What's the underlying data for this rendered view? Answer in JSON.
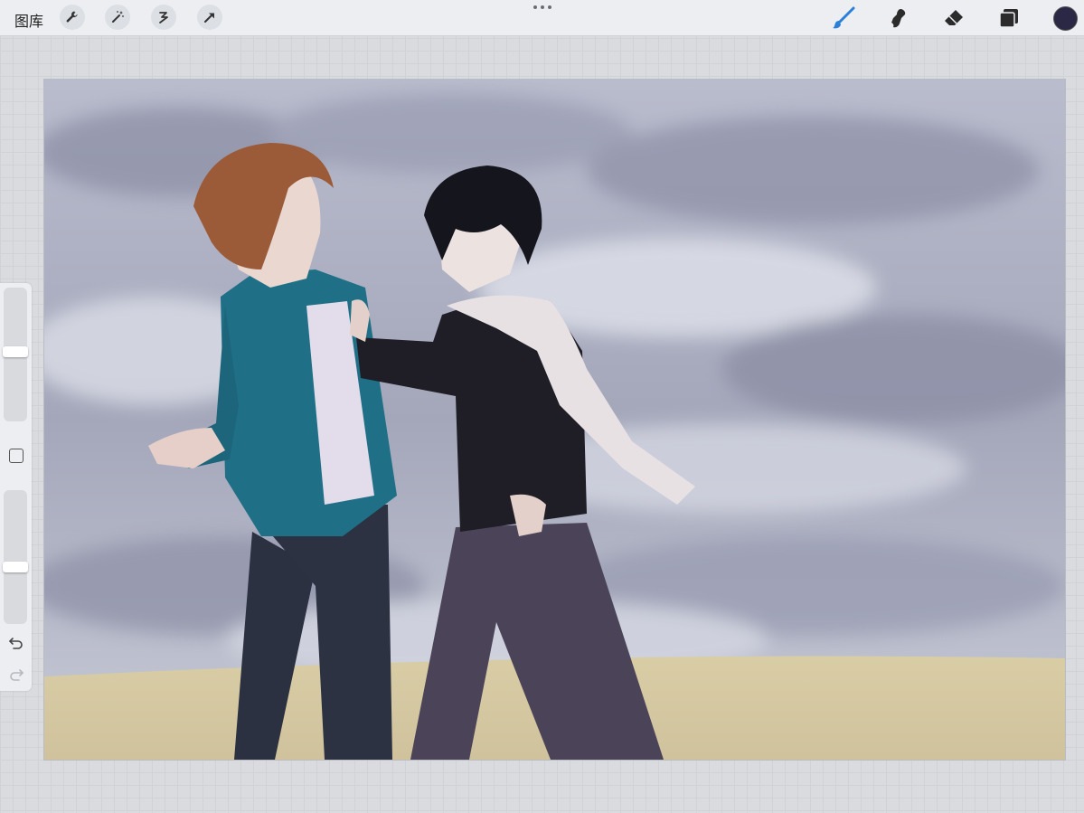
{
  "topbar": {
    "gallery_label": "图库",
    "left_tools": [
      "wrench-icon",
      "magic-wand-icon",
      "selection-icon",
      "transform-arrow-icon"
    ],
    "right_tools": [
      "brush-icon",
      "smudge-icon",
      "eraser-icon",
      "layers-icon"
    ],
    "active_tool": "brush",
    "current_color": "#2b2845"
  },
  "sidebar": {
    "brush_size": 0.52,
    "opacity": 0.42
  },
  "colors": {
    "toolbar_bg": "#eceef1",
    "accent": "#2a7fd6",
    "sky": "#9fa3b7",
    "ground": "#d8c99e"
  }
}
